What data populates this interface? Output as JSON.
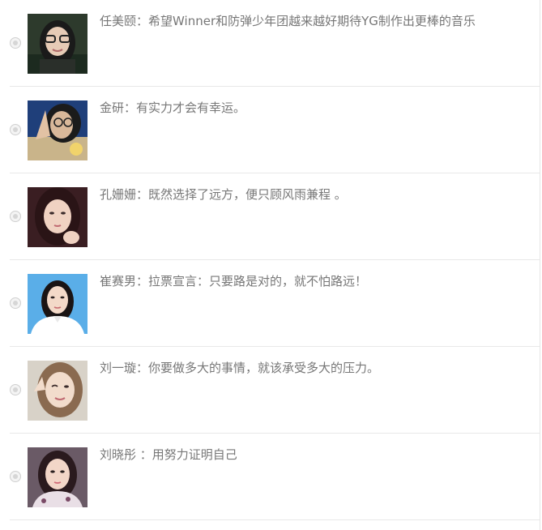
{
  "entries": [
    {
      "name": "任美颐",
      "separator": "：",
      "message": "希望Winner和防弹少年团越来越好期待YG制作出更棒的音乐"
    },
    {
      "name": "金研",
      "separator": "：",
      "message": "有实力才会有幸运。"
    },
    {
      "name": "孔姗姗",
      "separator": "：",
      "message": "既然选择了远方，便只顾风雨兼程 。"
    },
    {
      "name": "崔赛男",
      "separator": "：",
      "message": "拉票宣言：只要路是对的，就不怕路远！"
    },
    {
      "name": "刘一璇",
      "separator": "：",
      "message": "你要做多大的事情，就该承受多大的压力。"
    },
    {
      "name": "刘晓彤 ",
      "separator": "：",
      "message": "用努力证明自己"
    }
  ],
  "colors": {
    "text": "#777777",
    "divider": "#e8e8e8",
    "radio_border": "#cfcfcf"
  }
}
